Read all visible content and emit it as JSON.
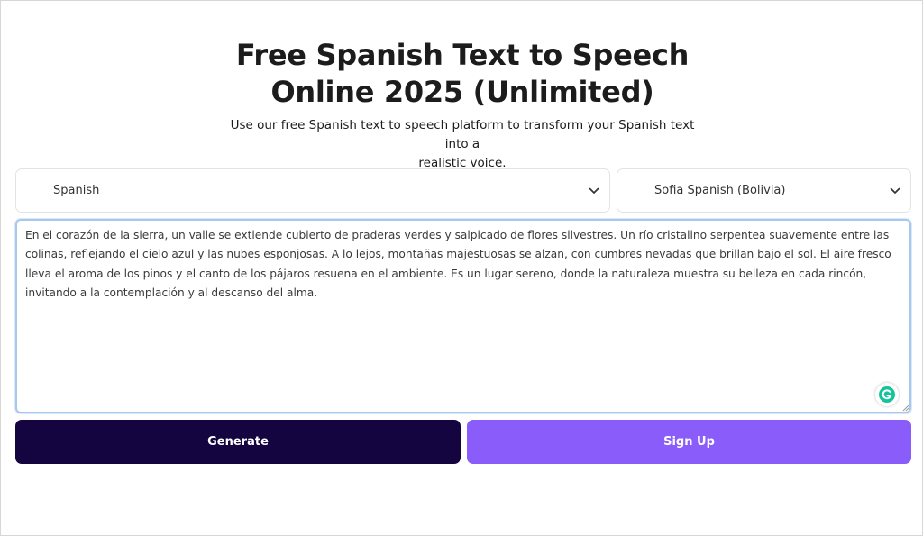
{
  "header": {
    "title_line1": "Free Spanish Text to Speech",
    "title_line2": "Online 2025 (Unlimited)",
    "subtitle_line1": "Use our free Spanish text to speech platform to transform your Spanish text into a",
    "subtitle_line2": "realistic voice."
  },
  "language_select": {
    "value": "Spanish",
    "icon": "chevron-down-icon"
  },
  "voice_select": {
    "value": "Sofia Spanish (Bolivia)",
    "icon": "chevron-down-icon"
  },
  "text_input": {
    "value": "En el corazón de la sierra, un valle se extiende cubierto de praderas verdes y salpicado de flores silvestres. Un río cristalino serpentea suavemente entre las colinas, reflejando el cielo azul y las nubes esponjosas. A lo lejos, montañas majestuosas se alzan, con cumbres nevadas que brillan bajo el sol. El aire fresco lleva el aroma de los pinos y el canto de los pájaros resuena en el ambiente. Es un lugar sereno, donde la naturaleza muestra su belleza en cada rincón, invitando a la contemplación y al descanso del alma."
  },
  "buttons": {
    "generate": "Generate",
    "signup": "Sign Up"
  },
  "colors": {
    "generate_bg": "#140540",
    "signup_bg": "#8a5cf9",
    "textarea_focus": "#a9c8ee",
    "grammarly": "#15c39a"
  }
}
